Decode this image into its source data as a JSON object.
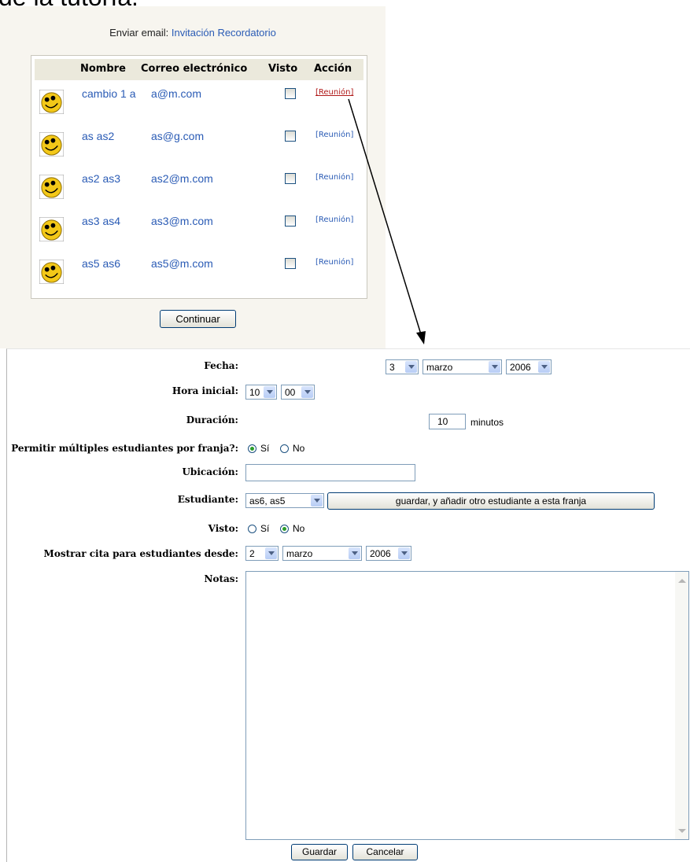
{
  "heading_fragment": "de la tutoría.",
  "email_prefix": "Enviar email:",
  "email_links": [
    "Invitación",
    "Recordatorio"
  ],
  "table": {
    "headers": {
      "name": "Nombre",
      "email": "Correo electrónico",
      "seen": "Visto",
      "action": "Acción"
    },
    "rows": [
      {
        "name": "cambio 1 a",
        "email": "a@m.com",
        "action": "[Reunión]",
        "active": true
      },
      {
        "name": "as as2",
        "email": "as@g.com",
        "action": "[Reunión]",
        "active": false
      },
      {
        "name": "as2 as3",
        "email": "as2@m.com",
        "action": "[Reunión]",
        "active": false
      },
      {
        "name": "as3 as4",
        "email": "as3@m.com",
        "action": "[Reunión]",
        "active": false
      },
      {
        "name": "as5 as6",
        "email": "as5@m.com",
        "action": "[Reunión]",
        "active": false
      }
    ]
  },
  "continue_label": "Continuar",
  "form": {
    "fecha_label": "Fecha:",
    "fecha": {
      "day": "3",
      "month": "marzo",
      "year": "2006"
    },
    "hora_label": "Hora inicial:",
    "hora": {
      "hour": "10",
      "minute": "00"
    },
    "duracion_label": "Duración:",
    "duracion_value": "10",
    "duracion_unit": "minutos",
    "multiples_label": "Permitir múltiples estudiantes por franja?:",
    "multiples_yes": "Sí",
    "multiples_no": "No",
    "ubicacion_label": "Ubicación:",
    "ubicacion_value": "",
    "estudiante_label": "Estudiante:",
    "estudiante_value": "as6, as5",
    "guardar_otro": "guardar, y añadir otro estudiante a esta franja",
    "visto_label": "Visto:",
    "visto_yes": "Sí",
    "visto_no": "No",
    "mostrar_label": "Mostrar cita para estudiantes desde:",
    "mostrar": {
      "day": "2",
      "month": "marzo",
      "year": "2006"
    },
    "notas_label": "Notas:",
    "notas_value": "",
    "guardar_label": "Guardar",
    "cancelar_label": "Cancelar"
  }
}
